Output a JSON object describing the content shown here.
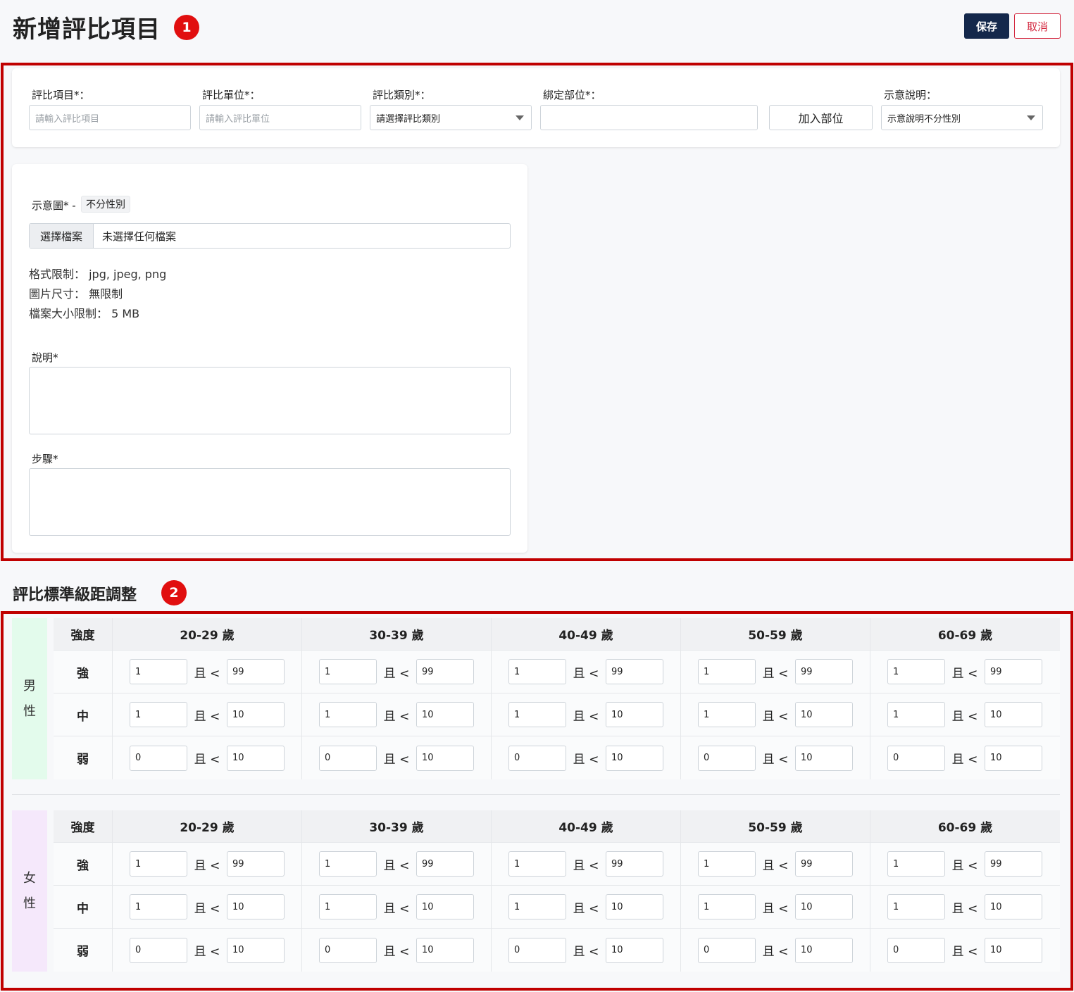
{
  "header": {
    "title": "新增評比項目",
    "badge1": "1",
    "save_label": "保存",
    "cancel_label": "取消"
  },
  "form": {
    "item_label": "評比項目*：",
    "item_placeholder": "請輸入評比項目",
    "unit_label": "評比單位*：",
    "unit_placeholder": "請輸入評比單位",
    "category_label": "評比類別*：",
    "category_value": "請選擇評比類別",
    "bind_label": "綁定部位*：",
    "bind_value": "",
    "add_part_label": "加入部位",
    "desc_mode_label": "示意說明：",
    "desc_mode_value": "示意說明不分性別"
  },
  "image": {
    "label": "示意圖* -",
    "gender_tag": "不分性別",
    "choose_file": "選擇檔案",
    "no_file": "未選擇任何檔案",
    "format_limit": "格式限制： jpg, jpeg, png",
    "size_limit": "圖片尺寸： 無限制",
    "file_size_limit": "檔案大小限制： 5 MB"
  },
  "texts": {
    "description_label": "說明*",
    "steps_label": "步驟*"
  },
  "standards": {
    "title": "評比標準級距調整",
    "badge2": "2",
    "strength_header": "強度",
    "ages": [
      "20-29 歲",
      "30-39 歲",
      "40-49 歲",
      "50-59 歲",
      "60-69 歲"
    ],
    "compare": "且 <",
    "groups": [
      {
        "gender_char1": "男",
        "gender_char2": "性",
        "gender_color": "#e3fbec",
        "rows": [
          {
            "level": "強",
            "min": [
              "1",
              "1",
              "1",
              "1",
              "1"
            ],
            "max": [
              "99",
              "99",
              "99",
              "99",
              "99"
            ]
          },
          {
            "level": "中",
            "min": [
              "1",
              "1",
              "1",
              "1",
              "1"
            ],
            "max": [
              "10",
              "10",
              "10",
              "10",
              "10"
            ]
          },
          {
            "level": "弱",
            "min": [
              "0",
              "0",
              "0",
              "0",
              "0"
            ],
            "max": [
              "10",
              "10",
              "10",
              "10",
              "10"
            ]
          }
        ]
      },
      {
        "gender_char1": "女",
        "gender_char2": "性",
        "gender_color": "#f5e8fb",
        "rows": [
          {
            "level": "強",
            "min": [
              "1",
              "1",
              "1",
              "1",
              "1"
            ],
            "max": [
              "99",
              "99",
              "99",
              "99",
              "99"
            ]
          },
          {
            "level": "中",
            "min": [
              "1",
              "1",
              "1",
              "1",
              "1"
            ],
            "max": [
              "10",
              "10",
              "10",
              "10",
              "10"
            ]
          },
          {
            "level": "弱",
            "min": [
              "0",
              "0",
              "0",
              "0",
              "0"
            ],
            "max": [
              "10",
              "10",
              "10",
              "10",
              "10"
            ]
          }
        ]
      }
    ]
  }
}
